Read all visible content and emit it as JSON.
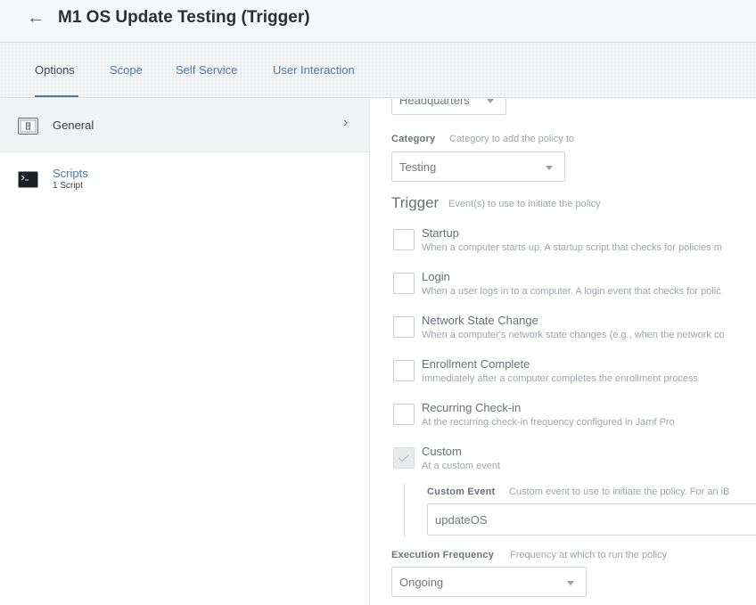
{
  "header": {
    "back_icon": "arrow-left-icon",
    "title": "M1 OS Update Testing (Trigger)"
  },
  "tabs": [
    {
      "label": "Options",
      "active": true
    },
    {
      "label": "Scope",
      "active": false
    },
    {
      "label": "Self Service",
      "active": false
    },
    {
      "label": "User Interaction",
      "active": false
    }
  ],
  "sidebar": {
    "items": [
      {
        "label": "General",
        "icon": "general-panel-icon",
        "selected": true
      },
      {
        "label": "Scripts",
        "sublabel": "1 Script",
        "icon": "terminal-icon",
        "selected": false
      }
    ]
  },
  "main": {
    "site_select": {
      "value": "Headquarters"
    },
    "category": {
      "label": "Category",
      "hint": "Category to add the policy to",
      "value": "Testing"
    },
    "trigger": {
      "title": "Trigger",
      "hint": "Event(s) to use to initiate the policy",
      "items": [
        {
          "label": "Startup",
          "desc": "When a computer starts up. A startup script that checks for policies m",
          "checked": false
        },
        {
          "label": "Login",
          "desc": "When a user logs in to a computer. A login event that checks for polic",
          "checked": false
        },
        {
          "label": "Network State Change",
          "desc": "When a computer's network state changes (e.g., when the network co",
          "checked": false
        },
        {
          "label": "Enrollment Complete",
          "desc": "Immediately after a computer completes the enrollment process",
          "checked": false
        },
        {
          "label": "Recurring Check-in",
          "desc": "At the recurring check-in frequency configured in Jamf Pro",
          "checked": false
        },
        {
          "label": "Custom",
          "desc": "At a custom event",
          "checked": true
        }
      ]
    },
    "custom_event": {
      "label": "Custom Event",
      "hint": "Custom event to use to initiate the policy. For an iB",
      "value": "updateOS"
    },
    "execution_frequency": {
      "label": "Execution Frequency",
      "hint": "Frequency at which to run the policy",
      "value": "Ongoing"
    }
  },
  "colors": {
    "accent": "#4e7aa8",
    "header_bg": "#f6f7f8",
    "selected_row_bg": "#f1f2f3"
  }
}
